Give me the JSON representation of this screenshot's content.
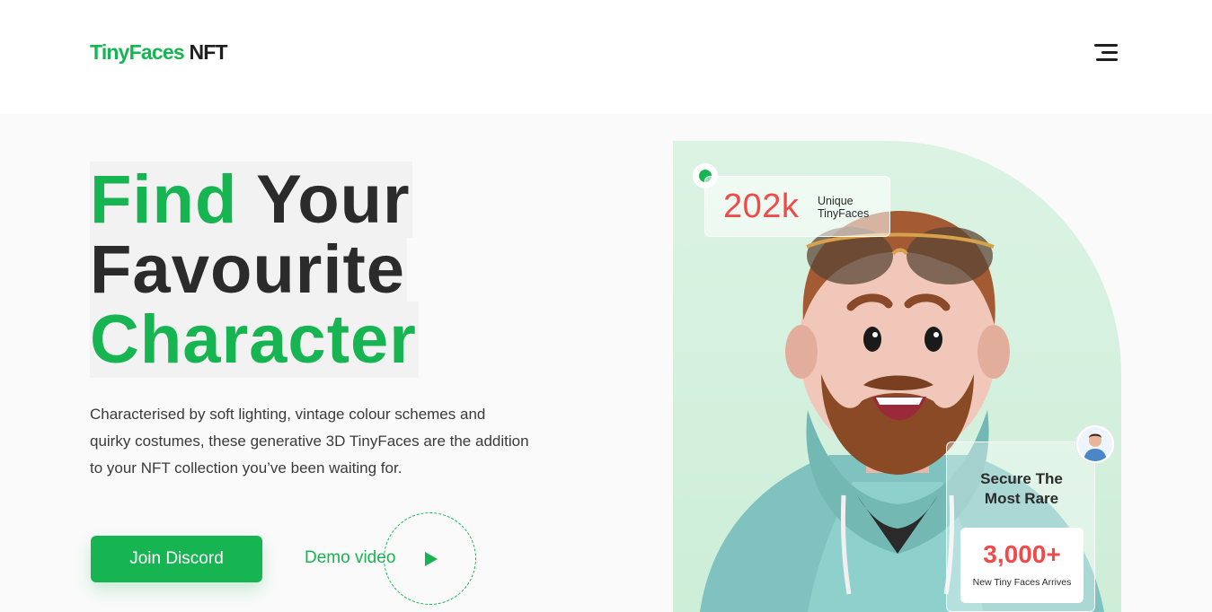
{
  "header": {
    "logo_primary": "TinyFaces",
    "logo_secondary": "NFT",
    "menu_icon": "hamburger-icon"
  },
  "hero": {
    "headline": {
      "word_find": "Find",
      "word_your": "Your",
      "word_favourite": "Favourite",
      "word_character": "Character"
    },
    "description": "Characterised by soft lighting, vintage colour schemes and quirky costumes, these generative 3D TinyFaces are the addition to your NFT collection you’ve been waiting for.",
    "join_button": "Join Discord",
    "demo_label": "Demo video",
    "play_icon": "play-icon"
  },
  "stats": {
    "value": "202k",
    "label_line1": "Unique",
    "label_line2": "TinyFaces"
  },
  "rare_card": {
    "title_line1": "Secure The",
    "title_line2": "Most Rare",
    "value": "3,000+",
    "subtitle": "New Tiny Faces Arrives"
  },
  "colors": {
    "brand_green": "#17b551",
    "accent_red": "#f04a4a",
    "panel_mint": "#d4f0de",
    "text_dark": "#2b2b2b"
  }
}
